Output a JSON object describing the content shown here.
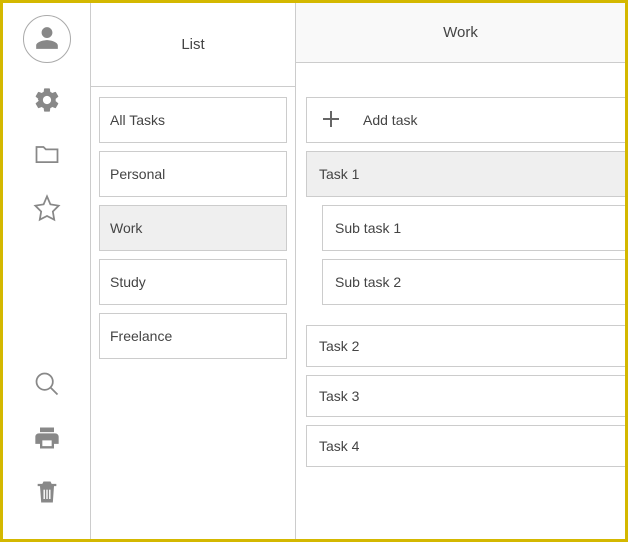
{
  "sidebar": {
    "icons": {
      "avatar": "user-icon",
      "settings": "gear-icon",
      "folder": "folder-icon",
      "star": "star-icon",
      "search": "search-icon",
      "print": "print-icon",
      "trash": "trash-icon"
    }
  },
  "list_panel": {
    "header": "List",
    "items": [
      {
        "label": "All Tasks",
        "selected": false
      },
      {
        "label": "Personal",
        "selected": false
      },
      {
        "label": "Work",
        "selected": true
      },
      {
        "label": "Study",
        "selected": false
      },
      {
        "label": "Freelance",
        "selected": false
      }
    ]
  },
  "work_panel": {
    "header": "Work",
    "add_label": "Add task",
    "tasks": [
      {
        "label": "Task 1",
        "selected": true,
        "subtasks": [
          {
            "label": "Sub task 1"
          },
          {
            "label": "Sub task 2"
          }
        ]
      },
      {
        "label": "Task 2"
      },
      {
        "label": "Task 3"
      },
      {
        "label": "Task 4"
      }
    ]
  }
}
